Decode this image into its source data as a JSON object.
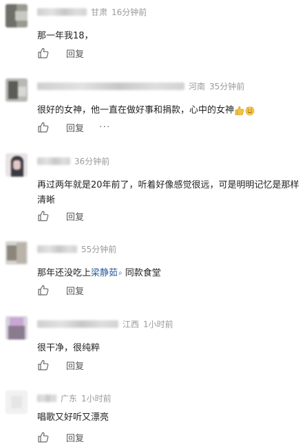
{
  "comments": [
    {
      "location": "甘肃",
      "time": "16分钟前",
      "text": "那一年我18，",
      "reply_label": "回复"
    },
    {
      "location": "河南",
      "time": "35分钟前",
      "text": "很好的女神，他一直在做好事和捐款，心中的女神",
      "reply_label": "回复",
      "more_label": "···",
      "emoji": [
        "thumbs-up-emoji",
        "smiling-face-emoji"
      ]
    },
    {
      "location": "",
      "time": "36分钟前",
      "text": "再过两年就是20年前了，听着好像感觉很远，可是明明记忆是那样清晰",
      "reply_label": "回复"
    },
    {
      "location": "",
      "time": "55分钟前",
      "text_before": "那年还没吃上",
      "mention": "梁静茹",
      "text_after": "同款食堂",
      "reply_label": "回复"
    },
    {
      "location": "江西",
      "time": "1小时前",
      "text": "很干净，很纯粹",
      "reply_label": "回复"
    },
    {
      "location": "广东",
      "time": "1小时前",
      "text": "唱歌又好听又漂亮",
      "reply_label": "回复"
    }
  ]
}
